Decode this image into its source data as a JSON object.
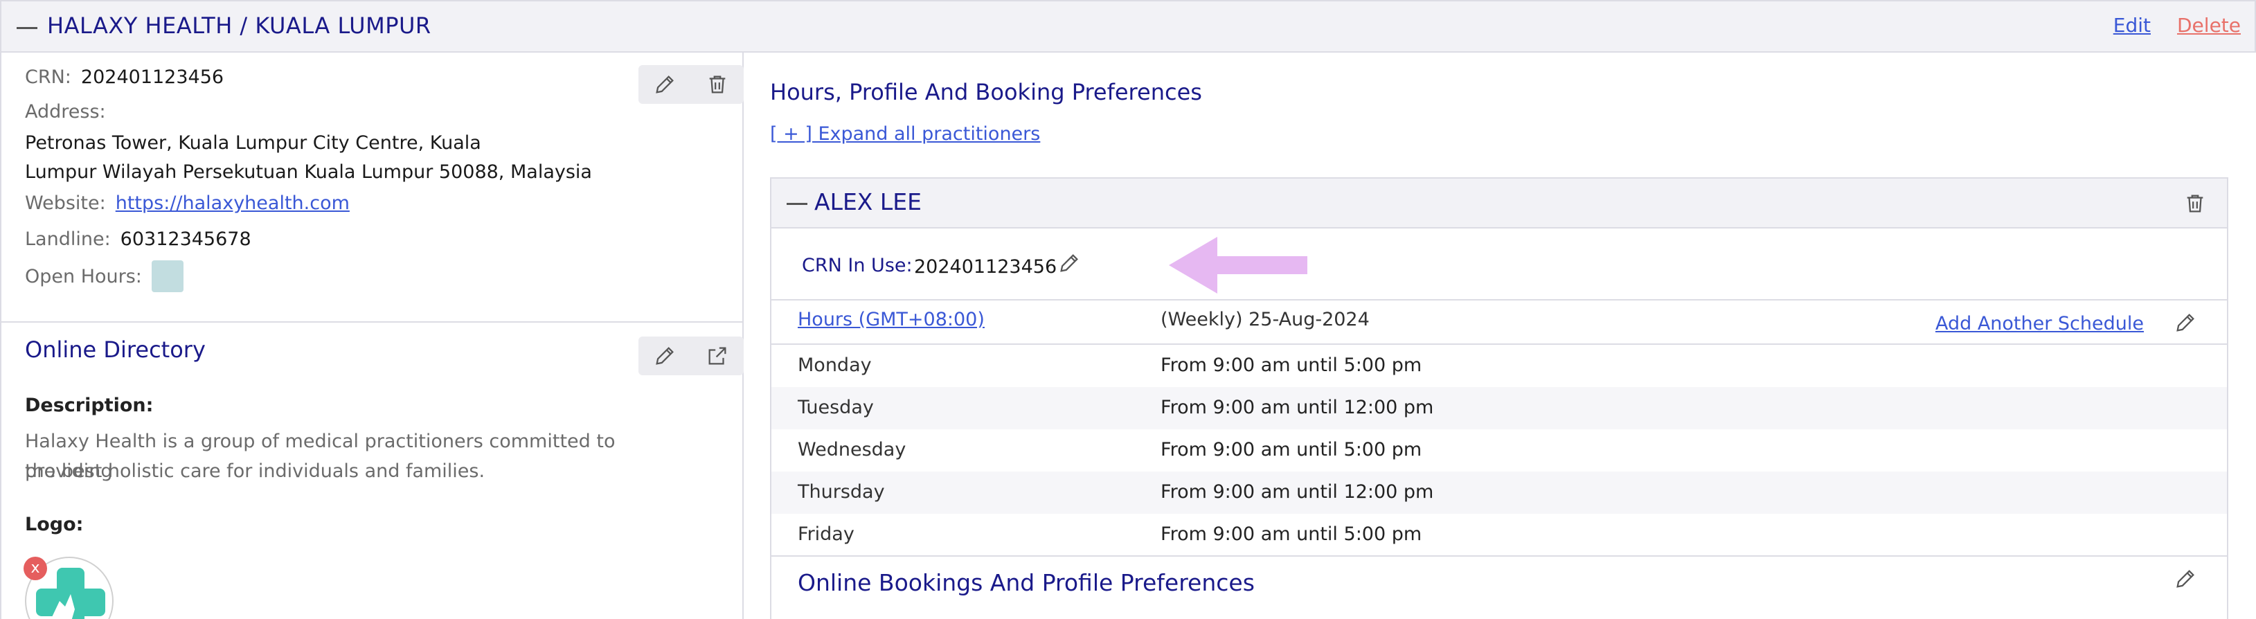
{
  "header": {
    "title": "HALAXY HEALTH / KUALA LUMPUR",
    "edit_label": "Edit",
    "delete_label": "Delete"
  },
  "organization": {
    "crn_label": "CRN:",
    "crn_value": "202401123456",
    "address_label": "Address:",
    "address_line1": "Petronas Tower, Kuala Lumpur City Centre, Kuala",
    "address_line2": "Lumpur Wilayah Persekutuan Kuala Lumpur 50088, Malaysia",
    "website_label": "Website:",
    "website_value": "https://halaxyhealth.com",
    "landline_label": "Landline:",
    "landline_value": "60312345678",
    "open_hours_label": "Open Hours:"
  },
  "directory": {
    "title": "Online Directory",
    "description_label": "Description:",
    "description_line1": "Halaxy Health is a group of medical practitioners committed to providing",
    "description_line2": "the best holistic care for individuals and families.",
    "logo_label": "Logo:",
    "logo_remove": "x"
  },
  "preferences": {
    "title": "Hours, Profile And Booking Preferences",
    "expand_label": "[ + ] Expand all practitioners"
  },
  "practitioner": {
    "name": "ALEX LEE",
    "crn_label": "CRN In Use:",
    "crn_value": "202401123456",
    "hours_link": "Hours (GMT+08:00)",
    "schedule_label": "(Weekly) 25-Aug-2024",
    "add_schedule_label": "Add Another Schedule",
    "schedule": [
      {
        "day": "Monday",
        "time": "From 9:00 am until 5:00 pm"
      },
      {
        "day": "Tuesday",
        "time": "From 9:00 am until 12:00 pm"
      },
      {
        "day": "Wednesday",
        "time": "From 9:00 am until 5:00 pm"
      },
      {
        "day": "Thursday",
        "time": "From 9:00 am until 12:00 pm"
      },
      {
        "day": "Friday",
        "time": "From 9:00 am until 5:00 pm"
      }
    ],
    "online_bookings_title": "Online Bookings And Profile Preferences"
  },
  "colors": {
    "heading": "#1a1a8a",
    "link": "#3a58d6",
    "delete": "#e8716a",
    "arrow": "#e6b8f2",
    "swatch": "#c2dde0"
  },
  "icons": [
    "pencil-icon",
    "trash-icon",
    "external-link-icon",
    "arrow-left-icon",
    "close-icon"
  ]
}
